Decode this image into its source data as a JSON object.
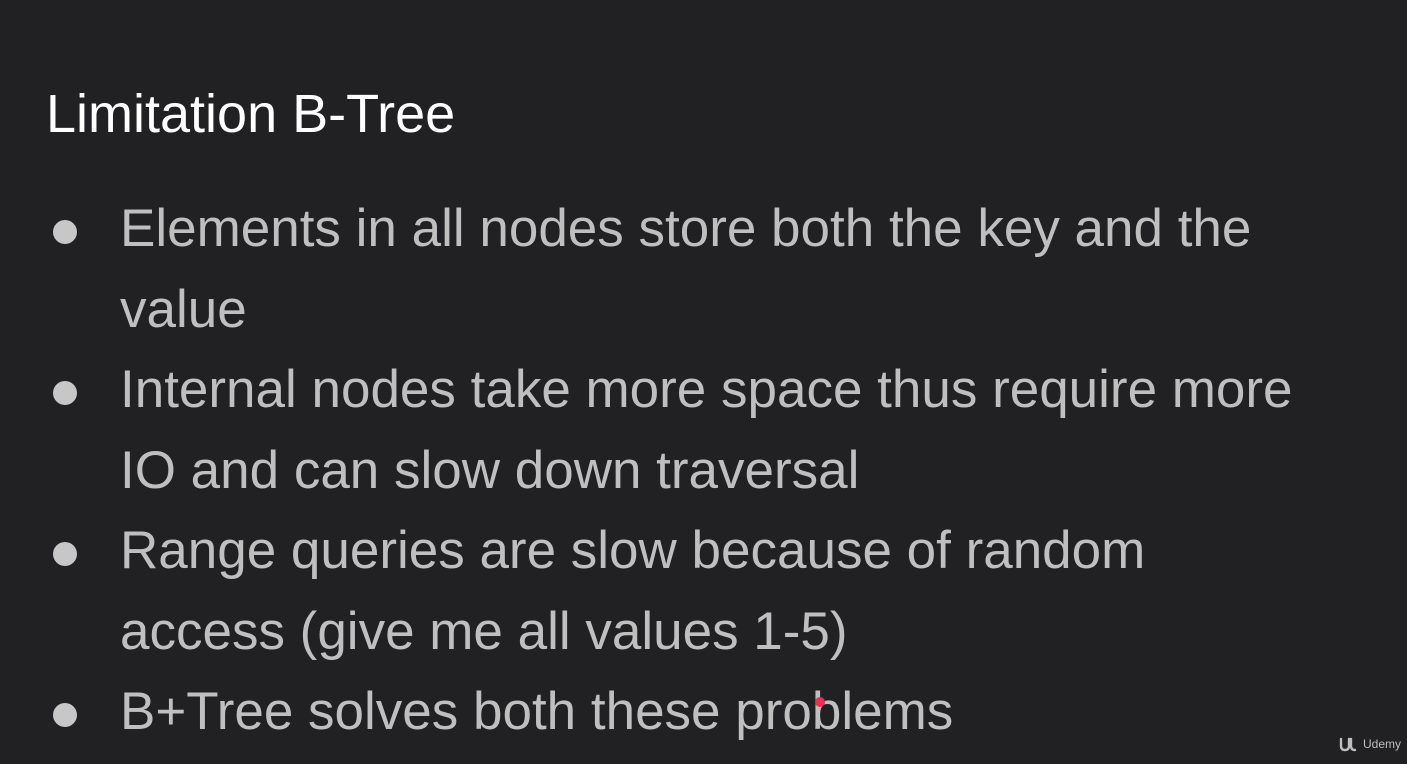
{
  "slide": {
    "title": "Limitation B-Tree",
    "bullets": [
      {
        "lines": [
          "Elements in all nodes store both the key and the",
          "value"
        ]
      },
      {
        "lines": [
          "Internal nodes take more space thus require more",
          "IO and can slow down traversal"
        ]
      },
      {
        "lines": [
          "Range queries are slow because of random",
          "access (give me all values 1-5)"
        ]
      },
      {
        "lines": [
          "B+Tree solves both these problems"
        ]
      }
    ]
  },
  "watermark": {
    "icon": "udemy-logo-icon",
    "label": "Udemy"
  },
  "colors": {
    "background": "#212123",
    "title": "#ffffff",
    "body_text": "#bfbfbf",
    "pointer": "#e8314a"
  }
}
